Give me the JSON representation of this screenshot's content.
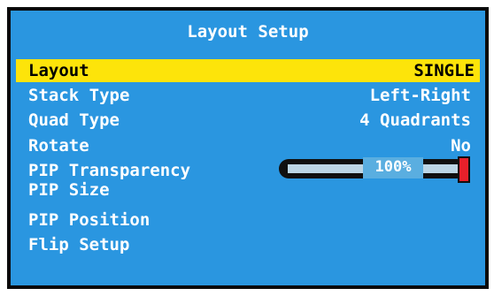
{
  "title": "Layout Setup",
  "menu": {
    "items": [
      {
        "label": "Layout",
        "value": "SINGLE",
        "selected": true
      },
      {
        "label": "Stack Type",
        "value": "Left-Right"
      },
      {
        "label": "Quad Type",
        "value": "4 Quadrants"
      },
      {
        "label": "Rotate",
        "value": "No"
      },
      {
        "label": "PIP Transparency",
        "value": ""
      },
      {
        "label": "PIP Size",
        "value": ""
      },
      {
        "label": "PIP Position",
        "value": ""
      },
      {
        "label": "Flip Setup",
        "value": ""
      }
    ]
  },
  "pip_transparency": {
    "percent_label": "100%",
    "level": 1.0
  },
  "colors": {
    "background": "#2a96e0",
    "selection": "#fde40a",
    "knob": "#e8202a",
    "text": "#ffffff"
  }
}
